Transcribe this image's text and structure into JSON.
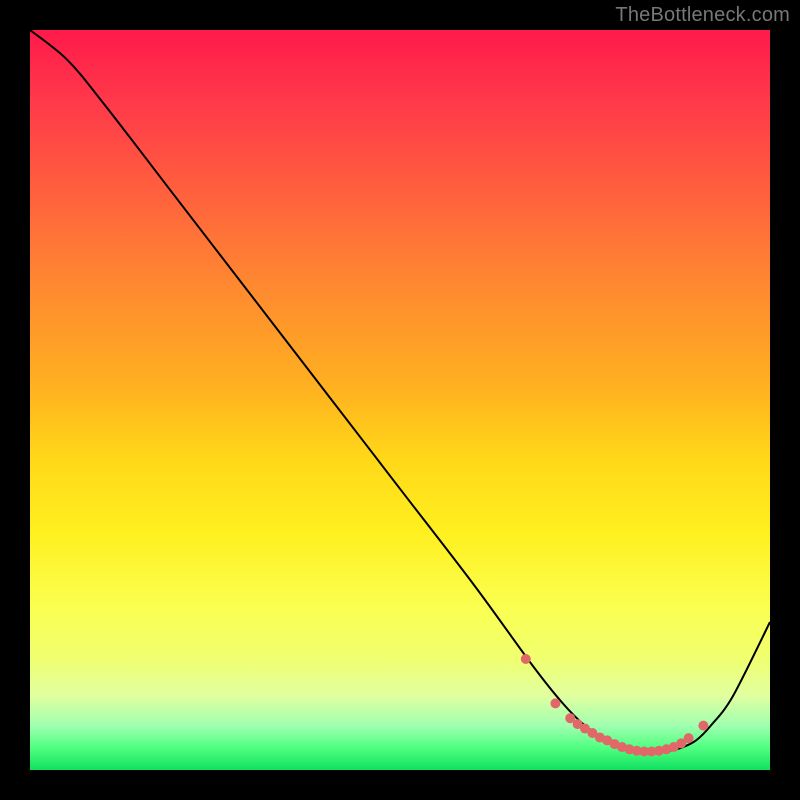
{
  "watermark": "TheBottleneck.com",
  "chart_data": {
    "type": "line",
    "title": "",
    "xlabel": "",
    "ylabel": "",
    "xlim": [
      0,
      100
    ],
    "ylim": [
      0,
      100
    ],
    "series": [
      {
        "name": "bottleneck-curve",
        "x": [
          0,
          5,
          10,
          20,
          30,
          40,
          50,
          60,
          68,
          72,
          75,
          78,
          80,
          82,
          84,
          86,
          88,
          90,
          92,
          95,
          100
        ],
        "y": [
          100,
          96,
          90,
          77,
          64,
          51,
          38,
          25,
          14,
          9,
          6,
          4,
          3,
          2.5,
          2.3,
          2.5,
          3,
          4,
          6,
          10,
          20
        ]
      }
    ],
    "markers": {
      "name": "highlight-dots",
      "x": [
        67,
        71,
        73,
        74,
        75,
        76,
        77,
        78,
        79,
        80,
        81,
        82,
        83,
        84,
        85,
        86,
        87,
        88,
        89,
        91
      ],
      "y": [
        15,
        9,
        7,
        6.2,
        5.6,
        5,
        4.4,
        4,
        3.5,
        3.1,
        2.8,
        2.6,
        2.5,
        2.5,
        2.6,
        2.8,
        3.1,
        3.6,
        4.3,
        6
      ],
      "color": "#e06868",
      "radius": 5
    },
    "curve_color": "#000000",
    "curve_width": 2
  }
}
